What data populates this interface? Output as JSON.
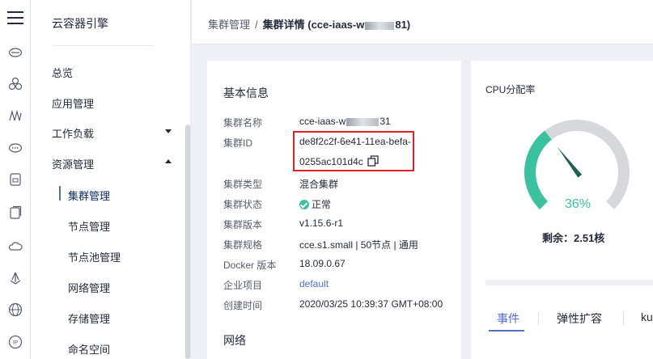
{
  "app": {
    "title": "云容器引擎"
  },
  "rail": {
    "icons": [
      "cloud-server-icon",
      "cluster-icon",
      "workload-icon",
      "network-icon",
      "storage-icon",
      "image-icon",
      "cloud-icon",
      "deploy-icon",
      "globe-icon",
      "ip-icon"
    ]
  },
  "sidebar": {
    "items": [
      {
        "label": "总览"
      },
      {
        "label": "应用管理"
      },
      {
        "label": "工作负载"
      },
      {
        "label": "资源管理"
      }
    ],
    "sub_items": [
      {
        "label": "集群管理"
      },
      {
        "label": "节点管理"
      },
      {
        "label": "节点池管理"
      },
      {
        "label": "网络管理"
      },
      {
        "label": "存储管理"
      },
      {
        "label": "命名空间"
      }
    ]
  },
  "breadcrumb": {
    "parent": "集群管理",
    "separator": "/",
    "current_prefix": "集群详情 (cce-iaas-w",
    "current_suffix": "81)"
  },
  "basic_info": {
    "title": "基本信息",
    "rows": [
      {
        "label": "集群名称",
        "value_prefix": "cce-iaas-w",
        "value_suffix": "31"
      },
      {
        "label": "集群ID",
        "value_line1": "de8f2c2f-6e41-11ea-befa-",
        "value_line2": "0255ac101d4c"
      },
      {
        "label": "集群类型",
        "value": "混合集群"
      },
      {
        "label": "集群状态",
        "value": "正常"
      },
      {
        "label": "集群版本",
        "value": "v1.15.6-r1"
      },
      {
        "label": "集群规格",
        "value": "cce.s1.small | 50节点 | 通用"
      },
      {
        "label": "Docker 版本",
        "value": "18.09.0.67"
      },
      {
        "label": "企业项目",
        "value": "default"
      },
      {
        "label": "创建时间",
        "value": "2020/03/25 10:39:37 GMT+08:00"
      }
    ],
    "network_title": "网络"
  },
  "cpu": {
    "title": "CPU分配率",
    "percent_text": "36%",
    "percent": 36,
    "remain_text": "剩余：2.51核",
    "colors": {
      "used": "#3ac1a0",
      "free": "#d6d8dc",
      "needle": "#1f5f55"
    }
  },
  "tabs": [
    {
      "label": "事件"
    },
    {
      "label": "弹性扩容"
    },
    {
      "label": "ku"
    }
  ]
}
